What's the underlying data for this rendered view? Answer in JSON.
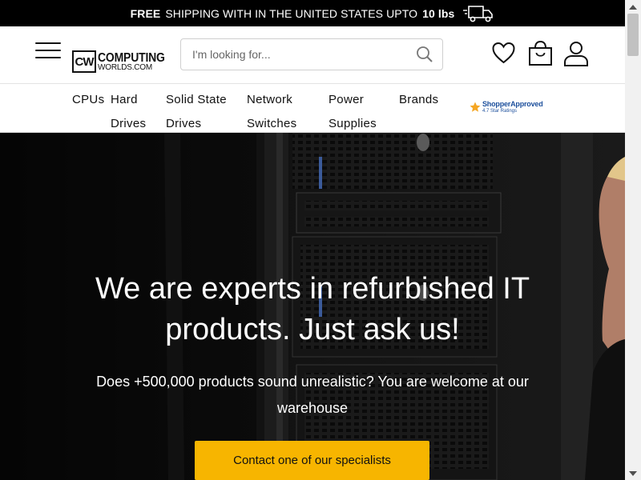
{
  "banner": {
    "free": "FREE",
    "text": "SHIPPING WITH IN THE UNITED STATES UPTO",
    "weight": "10 lbs",
    "icon": "truck-icon"
  },
  "header": {
    "logo_mark": "CW",
    "logo_line1": "COMPUTING",
    "logo_line2": "WORLDS.COM",
    "search_placeholder": "I'm looking for...",
    "icons": [
      "menu-icon",
      "search-icon",
      "heart-icon",
      "shopping-bag-icon",
      "user-icon"
    ]
  },
  "nav": {
    "items": [
      {
        "line1": "CPUs",
        "line2": ""
      },
      {
        "line1": "Hard",
        "line2": "Drives"
      },
      {
        "line1": "Solid State",
        "line2": "Drives"
      },
      {
        "line1": "Network",
        "line2": "Switches"
      },
      {
        "line1": "Power",
        "line2": "Supplies"
      },
      {
        "line1": "Brands",
        "line2": ""
      }
    ],
    "shopper_approved": {
      "name": "ShopperApproved",
      "rating": "4.7 Star Ratings"
    }
  },
  "hero": {
    "title_line1": "We are experts in refurbished IT",
    "title_line2": "products. Just ask us!",
    "subtitle_line1": "Does +500,000 products sound unrealistic? You are welcome at our",
    "subtitle_line2": "warehouse",
    "cta_label": "Contact one of our specialists"
  },
  "colors": {
    "banner_bg": "#000000",
    "cta_bg": "#f7b500",
    "brand_blue": "#1c4f9c"
  }
}
